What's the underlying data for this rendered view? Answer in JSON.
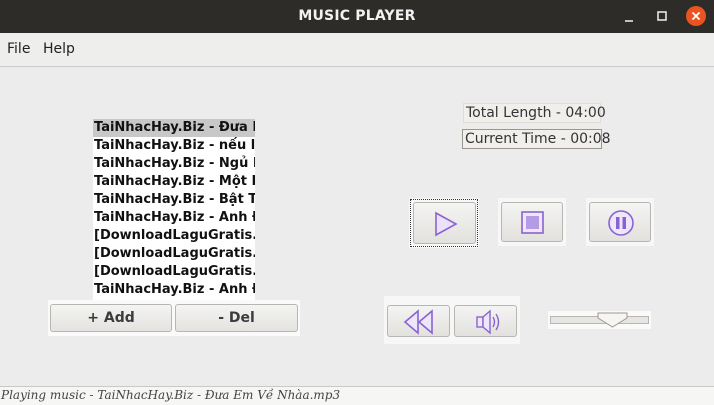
{
  "window": {
    "title": "MUSIC PLAYER",
    "controls": [
      "minimize-icon",
      "maximize-icon",
      "close-icon"
    ]
  },
  "menu": {
    "file": "File",
    "help": "Help"
  },
  "playlist": {
    "items": [
      "TaiNhacHay.Biz - Đưa Em Về Nhà",
      "TaiNhacHay.Biz - nếu lúc đó",
      "TaiNhacHay.Biz - Ngủ Một Mình",
      "TaiNhacHay.Biz - Một Ngày",
      "TaiNhacHay.Biz - Bật Tình Yêu Lên",
      "TaiNhacHay.Biz - Anh Đã Quen",
      "[DownloadLaguGratis.Net]",
      "[DownloadLaguGratis.Net]",
      "[DownloadLaguGratis.Net]",
      "TaiNhacHay.Biz - Anh Đợi Em"
    ],
    "selected_index": 0
  },
  "buttons": {
    "add": "+ Add",
    "del": "- Del"
  },
  "info": {
    "total_length": "Total Length - 04:00",
    "current_time": "Current Time - 00:08"
  },
  "controls": {
    "icons": [
      "play-icon",
      "stop-icon",
      "pause-icon",
      "rewind-icon",
      "volume-icon"
    ],
    "accent": "#8a63d2",
    "volume_level": 0.6
  },
  "status": {
    "text": "Playing music - TaiNhacHay.Biz - Đưa Em Về Nhàa.mp3"
  }
}
